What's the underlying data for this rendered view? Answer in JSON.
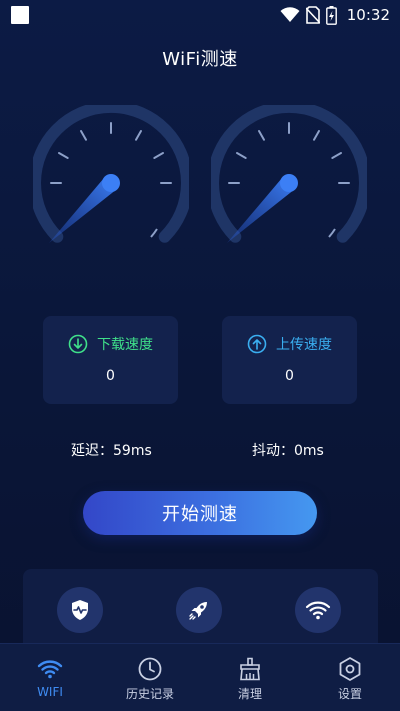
{
  "status_bar": {
    "time": "10:32"
  },
  "page": {
    "title": "WiFi测速"
  },
  "speed_cards": {
    "download": {
      "label": "下载速度",
      "value": "0",
      "color": "#3fe08a"
    },
    "upload": {
      "label": "上传速度",
      "value": "0",
      "color": "#3aaef0"
    }
  },
  "metrics": {
    "latency": "延迟：59ms",
    "jitter": "抖动：0ms"
  },
  "actions": {
    "start_label": "开始测速"
  },
  "tools": [
    {
      "icon": "shield-pulse-icon"
    },
    {
      "icon": "rocket-icon"
    },
    {
      "icon": "wifi-signal-icon"
    }
  ],
  "bottom_nav": {
    "items": [
      {
        "label": "WIFI",
        "icon": "wifi-icon",
        "active": true
      },
      {
        "label": "历史记录",
        "icon": "clock-icon",
        "active": false
      },
      {
        "label": "清理",
        "icon": "broom-icon",
        "active": false
      },
      {
        "label": "设置",
        "icon": "hexagon-settings-icon",
        "active": false
      }
    ]
  },
  "colors": {
    "accent": "#3f8cf2",
    "background": "#0c1b45",
    "card": "#13224d"
  }
}
